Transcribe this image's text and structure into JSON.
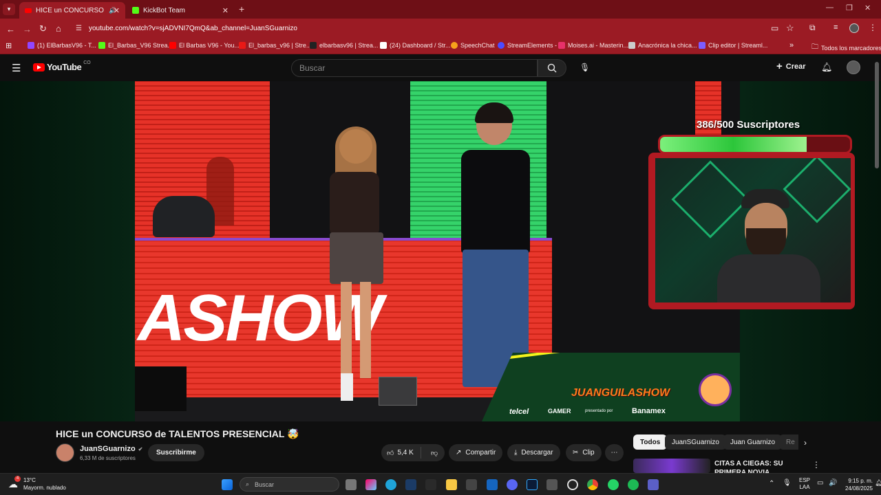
{
  "browser": {
    "tabs": [
      {
        "title": "HICE un CONCURSO de TALENTOS",
        "active": true
      },
      {
        "title": "KickBot Team",
        "active": false
      }
    ],
    "url": "youtube.com/watch?v=sjADVNI7QmQ&ab_channel=JuanSGuarnizo",
    "bookmarks": [
      {
        "label": "(1) ElBarbasV96 - T...",
        "color": "#9146ff"
      },
      {
        "label": "El_Barbas_V96 Strea...",
        "color": "#53fc18"
      },
      {
        "label": "El Barbas V96 - You...",
        "color": "#ff0000"
      },
      {
        "label": "El_barbas_v96 | Stre...",
        "color": "#e91916"
      },
      {
        "label": "elbarbasv96 | Strea...",
        "color": "#222222"
      },
      {
        "label": "(24) Dashboard / Str...",
        "color": "#ffffff"
      },
      {
        "label": "SpeechChat",
        "color": "#f7a21b"
      },
      {
        "label": "StreamElements -",
        "color": "#4b4bff"
      },
      {
        "label": "Moises.ai - Masterin...",
        "color": "#e8316a"
      },
      {
        "label": "Anacrónica la chica...",
        "color": "#cccccc"
      },
      {
        "label": "Clip editor | Streaml...",
        "color": "#7c5cff"
      }
    ],
    "bookmarks_folder": "Todos los marcadores"
  },
  "youtube": {
    "logo": "YouTube",
    "region": "CO",
    "search_placeholder": "Buscar",
    "create_label": "Crear"
  },
  "video": {
    "stage_text": "ASHOW",
    "overlay": {
      "subs_counter": "386/500 Suscriptores",
      "subs_progress": 0.772
    },
    "banner": {
      "show_name": "JUANGUILASHOW",
      "sponsor1": "telcel",
      "sponsor2": "GAMER",
      "presented_by": "presentado por",
      "sponsor3": "Banamex"
    }
  },
  "meta": {
    "title": "HICE un CONCURSO de TALENTOS PRESENCIAL 🤯",
    "channel": "JuanSGuarnizo",
    "subscribers": "6,33 M de suscriptores",
    "subscribe_label": "Suscribirme",
    "likes": "5,4 K",
    "share_label": "Compartir",
    "download_label": "Descargar",
    "clip_label": "Clip"
  },
  "sidebar": {
    "chips": [
      "Todos",
      "JuanSGuarnizo",
      "Juan Guarnizo",
      "Re"
    ],
    "first_video_title": "CITAS A CIEGAS: SU PRIMERA NOVIA"
  },
  "taskbar": {
    "weather_temp": "13°C",
    "weather_desc": "Mayorm. nublado",
    "search_placeholder": "Buscar",
    "lang_top": "ESP",
    "lang_bottom": "LAA",
    "time": "9:15 p. m.",
    "date": "24/08/2025",
    "notif_count": "4"
  }
}
